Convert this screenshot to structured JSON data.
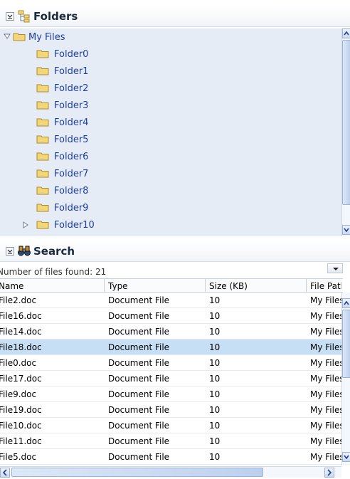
{
  "folders_panel": {
    "title": "Folders",
    "root": {
      "label": "My Files",
      "expanded": true
    },
    "items": [
      {
        "label": "Folder0"
      },
      {
        "label": "Folder1"
      },
      {
        "label": "Folder2"
      },
      {
        "label": "Folder3"
      },
      {
        "label": "Folder4"
      },
      {
        "label": "Folder5"
      },
      {
        "label": "Folder6"
      },
      {
        "label": "Folder7"
      },
      {
        "label": "Folder8"
      },
      {
        "label": "Folder9"
      },
      {
        "label": "Folder10",
        "expandable": true
      }
    ]
  },
  "search_panel": {
    "title": "Search",
    "result_count_text": "Number of files found: 21",
    "columns": [
      "Name",
      "Type",
      "Size (KB)",
      "File Path"
    ],
    "rows": [
      {
        "name": "File2.doc",
        "type": "Document File",
        "size": "10",
        "path": "My Files"
      },
      {
        "name": "File16.doc",
        "type": "Document File",
        "size": "10",
        "path": "My Files"
      },
      {
        "name": "File14.doc",
        "type": "Document File",
        "size": "10",
        "path": "My Files"
      },
      {
        "name": "File18.doc",
        "type": "Document File",
        "size": "10",
        "path": "My Files",
        "selected": true
      },
      {
        "name": "File0.doc",
        "type": "Document File",
        "size": "10",
        "path": "My Files"
      },
      {
        "name": "File17.doc",
        "type": "Document File",
        "size": "10",
        "path": "My Files"
      },
      {
        "name": "File9.doc",
        "type": "Document File",
        "size": "10",
        "path": "My Files"
      },
      {
        "name": "File19.doc",
        "type": "Document File",
        "size": "10",
        "path": "My Files"
      },
      {
        "name": "File10.doc",
        "type": "Document File",
        "size": "10",
        "path": "My Files"
      },
      {
        "name": "File11.doc",
        "type": "Document File",
        "size": "10",
        "path": "My Files"
      },
      {
        "name": "File5.doc",
        "type": "Document File",
        "size": "10",
        "path": "My Files"
      }
    ]
  },
  "colors": {
    "tree_bg": "#e5ecf6",
    "tree_text": "#1f3f9e",
    "selected_row": "#c6dff5",
    "folder_yellow": "#f2d67a"
  }
}
